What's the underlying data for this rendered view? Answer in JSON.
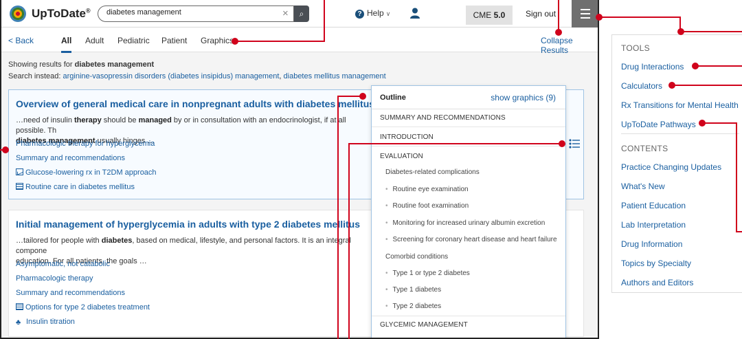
{
  "header": {
    "logo": "UpToDate",
    "logo_mark": "®",
    "search_value": "diabetes management",
    "help_label": "Help",
    "cme_label": "CME",
    "cme_value": "5.0",
    "signout_label": "Sign out"
  },
  "tabs": {
    "back": "Back",
    "items": [
      "All",
      "Adult",
      "Pediatric",
      "Patient",
      "Graphics"
    ],
    "collapse": "Collapse Results"
  },
  "results_info": {
    "showing_prefix": "Showing results for ",
    "showing_term": "diabetes management",
    "search_instead_prefix": "Search instead: ",
    "alt_1": "arginine-vasopressin disorders (diabetes insipidus) management",
    "separator": ", ",
    "alt_2": "diabetes mellitus management"
  },
  "card1": {
    "title": "Overview of general medical care in nonpregnant adults with diabetes mellitus",
    "snippet_a": "…need of insulin ",
    "snippet_b": "therapy",
    "snippet_c": " should be ",
    "snippet_d": "managed",
    "snippet_e": " by or in consultation with an endocrinologist, if at all possible. Th",
    "snippet_f": "diabetes management",
    "snippet_g": " usually hinges …",
    "links": [
      "Pharmacologic therapy for hyperglycemia",
      "Summary and recommendations",
      "Glucose-lowering rx in T2DM approach",
      "Routine care in diabetes mellitus"
    ]
  },
  "card2": {
    "title": "Initial management of hyperglycemia in adults with type 2 diabetes mellitus",
    "snippet_a": "…tailored for people with ",
    "snippet_b": "diabetes",
    "snippet_c": ", based on medical, lifestyle, and personal factors. It is an integral compone",
    "snippet_d": "education. For all patients, the goals …",
    "links": [
      "Asymptomatic, not catabolic",
      "Pharmacologic therapy",
      "Summary and recommendations",
      "Options for type 2 diabetes treatment",
      "Insulin titration"
    ]
  },
  "outline": {
    "title": "Outline",
    "show_graphics": "show graphics (9)",
    "sections": [
      "SUMMARY AND RECOMMENDATIONS",
      "INTRODUCTION"
    ],
    "evaluation": "EVALUATION",
    "sub_1": "Diabetes-related complications",
    "items_1": [
      "Routine eye examination",
      "Routine foot examination",
      "Monitoring for increased urinary albumin excretion",
      "Screening for coronary heart disease and heart failure"
    ],
    "sub_2": "Comorbid conditions",
    "items_2": [
      "Type 1 or type 2 diabetes",
      "Type 1 diabetes",
      "Type 2 diabetes"
    ],
    "glycemic": "GLYCEMIC MANAGEMENT"
  },
  "tools_panel": {
    "tools_heading": "TOOLS",
    "tools": [
      "Drug Interactions",
      "Calculators",
      "Rx Transitions for Mental Health",
      "UpToDate Pathways"
    ],
    "contents_heading": "CONTENTS",
    "contents": [
      "Practice Changing Updates",
      "What's New",
      "Patient Education",
      "Lab Interpretation",
      "Drug Information",
      "Topics by Specialty",
      "Authors and Editors"
    ]
  },
  "colors": {
    "link_blue": "#1a5fa0",
    "annotation_red": "#d0021b",
    "menu_gray": "#6f6f6f"
  }
}
